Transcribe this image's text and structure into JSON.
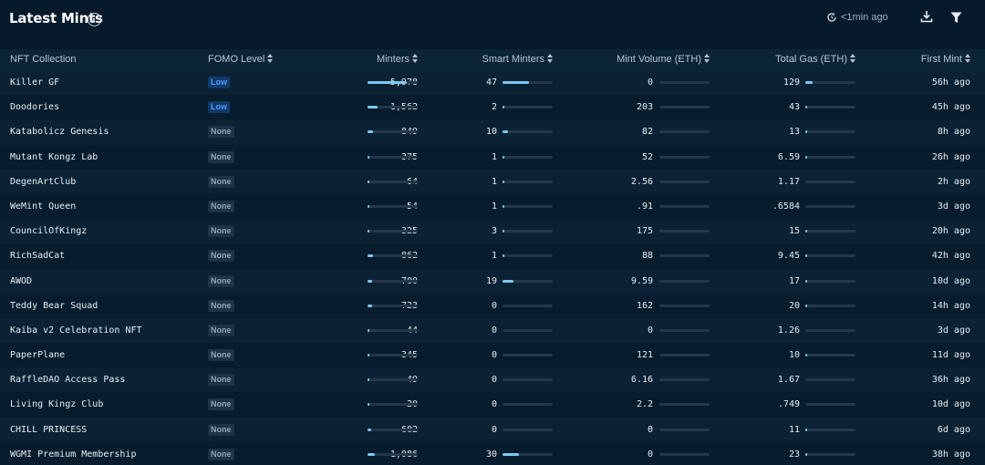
{
  "header": {
    "title": "Latest Mints",
    "refresh_label": "<1min ago"
  },
  "columns": {
    "collection": "NFT Collection",
    "fomo": "FOMO Level",
    "minters": "Minters",
    "smart_minters": "Smart Minters",
    "mint_volume": "Mint Volume (ETH)",
    "total_gas": "Total Gas (ETH)",
    "first_mint": "First Mint"
  },
  "colors": {
    "background": "#061a2b",
    "bar_fill": "#7cc8f2",
    "fomo_low": "#4c9bff"
  },
  "rows": [
    {
      "name": "Killer GF",
      "fomo": "Low",
      "minters": "5,978",
      "minters_pct": 0.78,
      "smart": "47",
      "smart_pct": 0.52,
      "volume": "0",
      "volume_pct": 0,
      "gas": "129",
      "gas_pct": 0.15,
      "first": "56h ago"
    },
    {
      "name": "Doodories",
      "fomo": "Low",
      "minters": "1,562",
      "minters_pct": 0.2,
      "smart": "2",
      "smart_pct": 0.02,
      "volume": "203",
      "volume_pct": 0,
      "gas": "43",
      "gas_pct": 0.04,
      "first": "45h ago"
    },
    {
      "name": "Katabolicz Genesis",
      "fomo": "None",
      "minters": "849",
      "minters_pct": 0.11,
      "smart": "10",
      "smart_pct": 0.1,
      "volume": "82",
      "volume_pct": 0,
      "gas": "13",
      "gas_pct": 0.01,
      "first": "8h ago"
    },
    {
      "name": "Mutant Kongz Lab",
      "fomo": "None",
      "minters": "375",
      "minters_pct": 0.04,
      "smart": "1",
      "smart_pct": 0.01,
      "volume": "52",
      "volume_pct": 0,
      "gas": "6.59",
      "gas_pct": 0.01,
      "first": "26h ago"
    },
    {
      "name": "DegenArtClub",
      "fomo": "None",
      "minters": "64",
      "minters_pct": 0.01,
      "smart": "1",
      "smart_pct": 0.01,
      "volume": "2.56",
      "volume_pct": 0,
      "gas": "1.17",
      "gas_pct": 0.0,
      "first": "2h ago"
    },
    {
      "name": "WeMint Queen",
      "fomo": "None",
      "minters": "54",
      "minters_pct": 0.01,
      "smart": "1",
      "smart_pct": 0.01,
      "volume": ".91",
      "volume_pct": 0,
      "gas": ".6584",
      "gas_pct": 0.0,
      "first": "3d ago"
    },
    {
      "name": "CouncilOfKingz",
      "fomo": "None",
      "minters": "325",
      "minters_pct": 0.04,
      "smart": "3",
      "smart_pct": 0.02,
      "volume": "175",
      "volume_pct": 0,
      "gas": "15",
      "gas_pct": 0.01,
      "first": "20h ago"
    },
    {
      "name": "RichSadCat",
      "fomo": "None",
      "minters": "862",
      "minters_pct": 0.11,
      "smart": "1",
      "smart_pct": 0.01,
      "volume": "88",
      "volume_pct": 0,
      "gas": "9.45",
      "gas_pct": 0.01,
      "first": "42h ago"
    },
    {
      "name": "AWOD",
      "fomo": "None",
      "minters": "700",
      "minters_pct": 0.09,
      "smart": "19",
      "smart_pct": 0.21,
      "volume": "9.59",
      "volume_pct": 0,
      "gas": "17",
      "gas_pct": 0.01,
      "first": "10d ago"
    },
    {
      "name": "Teddy Bear Squad",
      "fomo": "None",
      "minters": "723",
      "minters_pct": 0.09,
      "smart": "0",
      "smart_pct": 0,
      "volume": "162",
      "volume_pct": 0,
      "gas": "20",
      "gas_pct": 0.02,
      "first": "14h ago"
    },
    {
      "name": "Kaiba v2 Celebration NFT",
      "fomo": "None",
      "minters": "44",
      "minters_pct": 0.01,
      "smart": "0",
      "smart_pct": 0,
      "volume": "0",
      "volume_pct": 0,
      "gas": "1.26",
      "gas_pct": 0.0,
      "first": "3d ago"
    },
    {
      "name": "PaperPlane",
      "fomo": "None",
      "minters": "345",
      "minters_pct": 0.04,
      "smart": "0",
      "smart_pct": 0,
      "volume": "121",
      "volume_pct": 0,
      "gas": "10",
      "gas_pct": 0.01,
      "first": "11d ago"
    },
    {
      "name": "RaffleDAO Access Pass",
      "fomo": "None",
      "minters": "49",
      "minters_pct": 0.01,
      "smart": "0",
      "smart_pct": 0,
      "volume": "6.16",
      "volume_pct": 0,
      "gas": "1.67",
      "gas_pct": 0.0,
      "first": "36h ago"
    },
    {
      "name": "Living Kingz Club",
      "fomo": "None",
      "minters": "20",
      "minters_pct": 0.01,
      "smart": "0",
      "smart_pct": 0,
      "volume": "2.2",
      "volume_pct": 0,
      "gas": ".749",
      "gas_pct": 0.0,
      "first": "10d ago"
    },
    {
      "name": "CHILL PRINCESS",
      "fomo": "None",
      "minters": "602",
      "minters_pct": 0.08,
      "smart": "0",
      "smart_pct": 0,
      "volume": "0",
      "volume_pct": 0,
      "gas": "11",
      "gas_pct": 0.01,
      "first": "6d ago"
    },
    {
      "name": "WGMI Premium Membership",
      "fomo": "None",
      "minters": "1,086",
      "minters_pct": 0.14,
      "smart": "30",
      "smart_pct": 0.33,
      "volume": "0",
      "volume_pct": 0,
      "gas": "23",
      "gas_pct": 0.02,
      "first": "38h ago"
    }
  ]
}
